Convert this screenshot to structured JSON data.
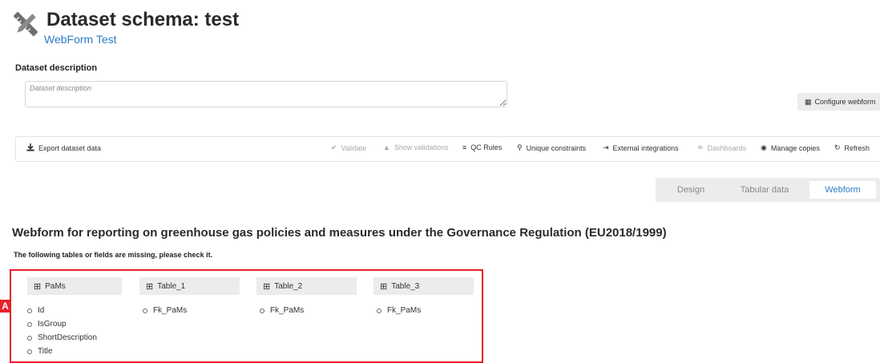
{
  "header": {
    "title": "Dataset schema: test",
    "subtitle": "WebForm Test",
    "icon": "pencil-ruler-icon"
  },
  "description": {
    "label": "Dataset description",
    "placeholder": "Dataset description",
    "value": ""
  },
  "configure_webform": {
    "label": "Configure webform",
    "icon": "table-icon"
  },
  "toolbar": {
    "export": {
      "label": "Export dataset data",
      "icon": "download-icon"
    },
    "items": [
      {
        "label": "Validate",
        "icon": "check-circle-icon",
        "enabled": false
      },
      {
        "label": "Show validations",
        "icon": "warning-icon",
        "enabled": false
      },
      {
        "label": "QC Rules",
        "icon": "list-check-icon",
        "enabled": true
      },
      {
        "label": "Unique constraints",
        "icon": "key-icon",
        "enabled": true
      },
      {
        "label": "External integrations",
        "icon": "sign-in-icon",
        "enabled": true
      },
      {
        "label": "Dashboards",
        "icon": "chart-icon",
        "enabled": false
      },
      {
        "label": "Manage copies",
        "icon": "camera-icon",
        "enabled": true
      },
      {
        "label": "Refresh",
        "icon": "refresh-icon",
        "enabled": true
      }
    ]
  },
  "tabs": [
    {
      "label": "Design",
      "active": false
    },
    {
      "label": "Tabular data",
      "active": false
    },
    {
      "label": "Webform",
      "active": true
    }
  ],
  "webform": {
    "title": "Webform for reporting on greenhouse gas policies and measures under the Governance Regulation (EU2018/1999)",
    "missing_message": "The following tables or fields are missing, please check it.",
    "annotation_marker": "A",
    "tables": [
      {
        "name": "PaMs",
        "fields": [
          "Id",
          "IsGroup",
          "ShortDescription",
          "Title"
        ]
      },
      {
        "name": "Table_1",
        "fields": [
          "Fk_PaMs"
        ]
      },
      {
        "name": "Table_2",
        "fields": [
          "Fk_PaMs"
        ]
      },
      {
        "name": "Table_3",
        "fields": [
          "Fk_PaMs"
        ]
      }
    ]
  },
  "colors": {
    "accent": "#2d7bc4",
    "annotation": "#e8202a",
    "tab_bar": "#ececec",
    "disabled": "#aaaaaa"
  }
}
